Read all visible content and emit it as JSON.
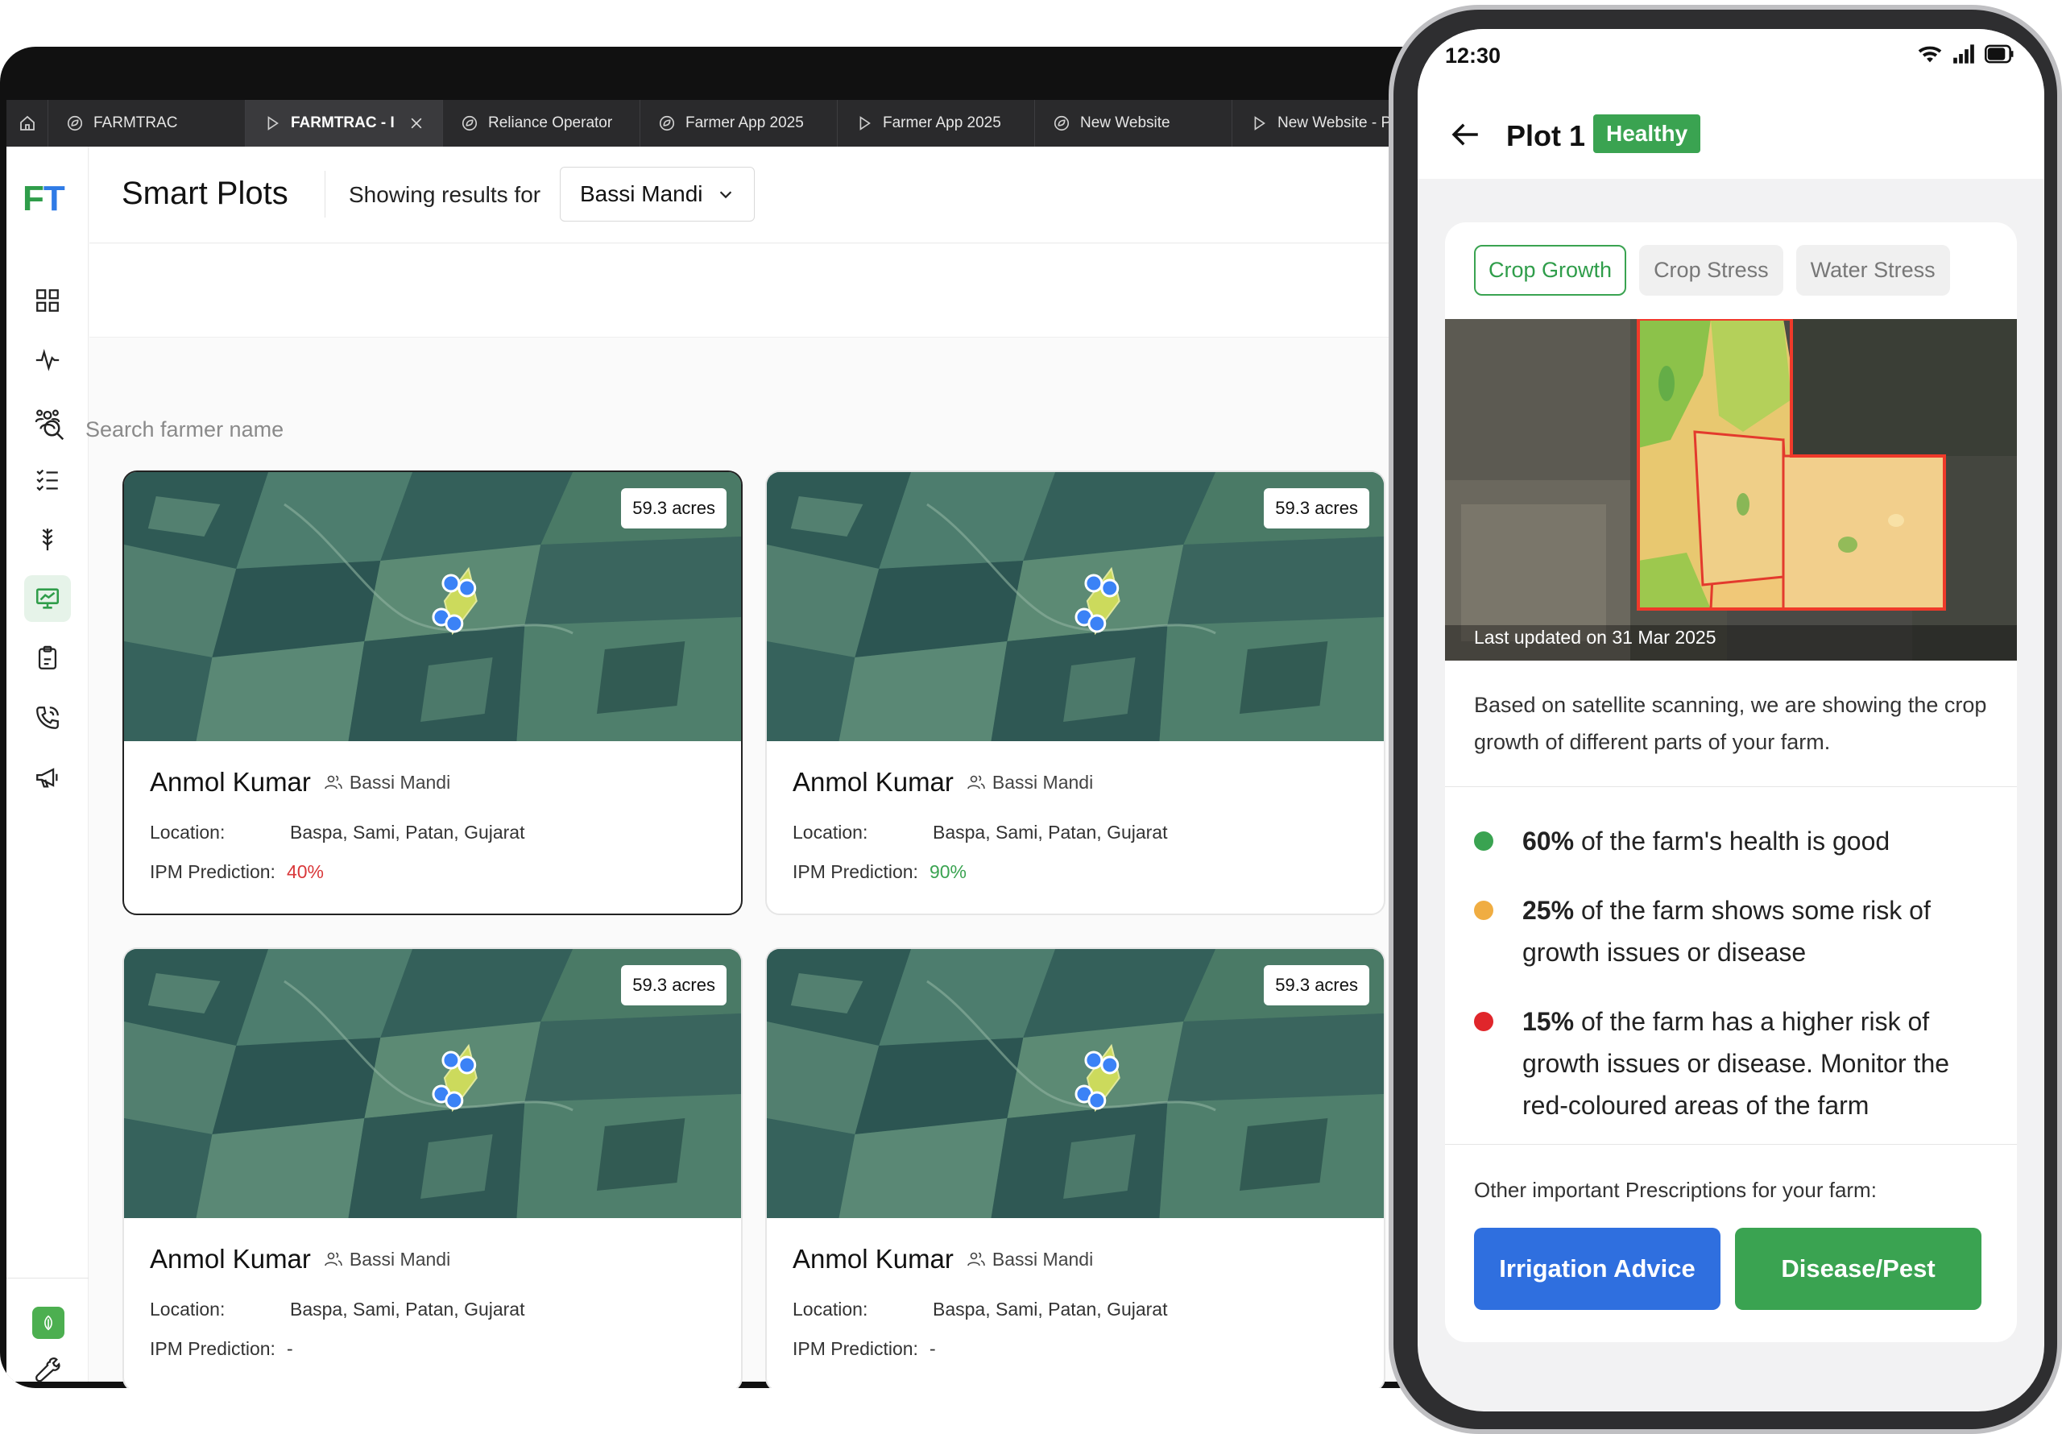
{
  "browser": {
    "tabs": [
      {
        "label": "FARMTRAC",
        "icon": "leaf-icon"
      },
      {
        "label": "FARMTRAC - I",
        "icon": "play-icon",
        "active": true
      },
      {
        "label": "Reliance Operator",
        "icon": "leaf-icon"
      },
      {
        "label": "Farmer App 2025",
        "icon": "leaf-icon"
      },
      {
        "label": "Farmer App 2025",
        "icon": "play-icon"
      },
      {
        "label": "New Website",
        "icon": "leaf-icon"
      },
      {
        "label": "New Website - P",
        "icon": "play-icon"
      }
    ]
  },
  "sidebar": {
    "logo_f": "F",
    "logo_t": "T",
    "items": [
      "dashboard-icon",
      "activity-icon",
      "farmers-icon",
      "tasks-icon",
      "crop-icon",
      "smart-plots-icon",
      "clipboard-icon",
      "phone-call-icon",
      "megaphone-icon"
    ],
    "active": "smart-plots-icon"
  },
  "header": {
    "title": "Smart Plots",
    "showing_label": "Showing results for",
    "mandi_selected": "Bassi Mandi"
  },
  "search": {
    "placeholder": "Search farmer name"
  },
  "labels": {
    "location": "Location:",
    "ipm": "IPM Prediction:"
  },
  "cards": [
    {
      "acres": "59.3 acres",
      "name": "Anmol Kumar",
      "mandi": "Bassi Mandi",
      "location": "Baspa, Sami, Patan, Gujarat",
      "ipm": "40%",
      "ipm_status": "red"
    },
    {
      "acres": "59.3 acres",
      "name": "Anmol Kumar",
      "mandi": "Bassi Mandi",
      "location": "Baspa, Sami, Patan, Gujarat",
      "ipm": "90%",
      "ipm_status": "green"
    },
    {
      "acres": "59.3 acres",
      "name": "Anmol Kumar",
      "mandi": "Bassi Mandi",
      "location": "Baspa, Sami, Patan, Gujarat",
      "ipm": "-",
      "ipm_status": "none"
    },
    {
      "acres": "59.3 acres",
      "name": "Anmol Kumar",
      "mandi": "Bassi Mandi",
      "location": "Baspa, Sami, Patan, Gujarat",
      "ipm": "-",
      "ipm_status": "none"
    }
  ],
  "phone": {
    "time": "12:30",
    "title": "Plot 1",
    "status_badge": "Healthy",
    "tabs": [
      "Crop Growth",
      "Crop Stress",
      "Water Stress"
    ],
    "active_tab": "Crop Growth",
    "last_updated": "Last updated on 31 Mar 2025",
    "description": "Based on satellite scanning, we are showing the crop growth of different parts of your farm.",
    "legend": [
      {
        "color": "#3aa351",
        "pct": "60%",
        "text": " of the farm's health is good"
      },
      {
        "color": "#f0ad42",
        "pct": "25%",
        "text": " of the farm shows some risk of growth issues or disease"
      },
      {
        "color": "#e0262b",
        "pct": "15%",
        "text": " of the farm has a higher risk of growth issues or disease. Monitor the red-coloured areas of the farm"
      }
    ],
    "other_label": "Other important Prescriptions for your farm:",
    "btn_irrigation": "Irrigation Advice",
    "btn_disease": "Disease/Pest"
  },
  "colors": {
    "brand_green": "#3aa351",
    "brand_blue": "#2f6fdf",
    "risk_red": "#d9383a"
  }
}
